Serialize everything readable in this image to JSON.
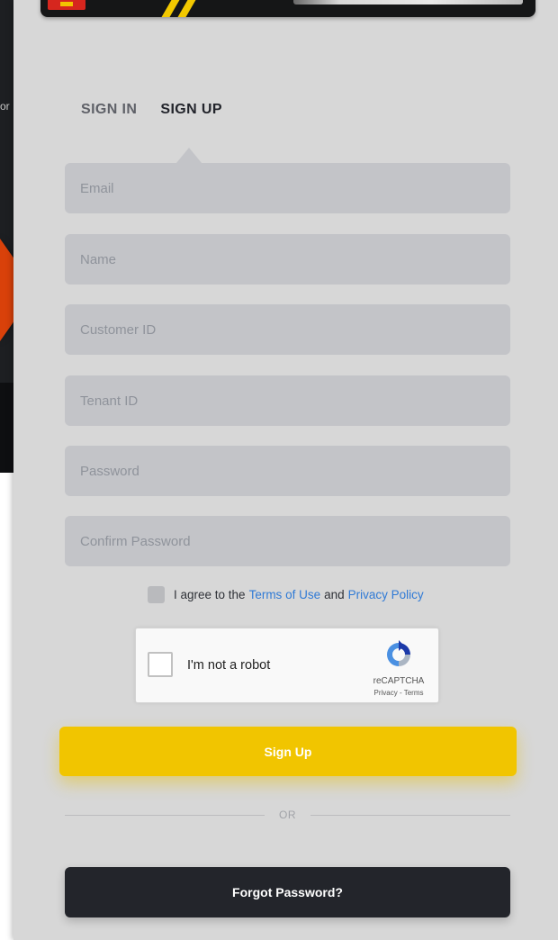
{
  "background": {
    "text_fragment": "or"
  },
  "tabs": [
    {
      "label": "SIGN IN",
      "active": false
    },
    {
      "label": "SIGN UP",
      "active": true
    }
  ],
  "form": {
    "email_placeholder": "Email",
    "name_placeholder": "Name",
    "customer_id_placeholder": "Customer ID",
    "tenant_id_placeholder": "Tenant ID",
    "password_placeholder": "Password",
    "confirm_password_placeholder": "Confirm Password"
  },
  "agree": {
    "prefix": "I agree to the",
    "terms_link": "Terms of Use",
    "conjunction": "and",
    "privacy_link": "Privacy Policy"
  },
  "captcha": {
    "label": "I'm not a robot",
    "brand": "reCAPTCHA",
    "links": "Privacy - Terms"
  },
  "buttons": {
    "sign_up": "Sign Up",
    "divider": "OR",
    "forgot_password": "Forgot Password?"
  },
  "colors": {
    "accent": "#f1c500",
    "dark_button": "#23252b",
    "link": "#2f7ad6",
    "panel": "#d7d7d7",
    "field": "#c3c4c8"
  },
  "icons": [
    "recaptcha-logo-icon",
    "banner-logo-icon"
  ]
}
